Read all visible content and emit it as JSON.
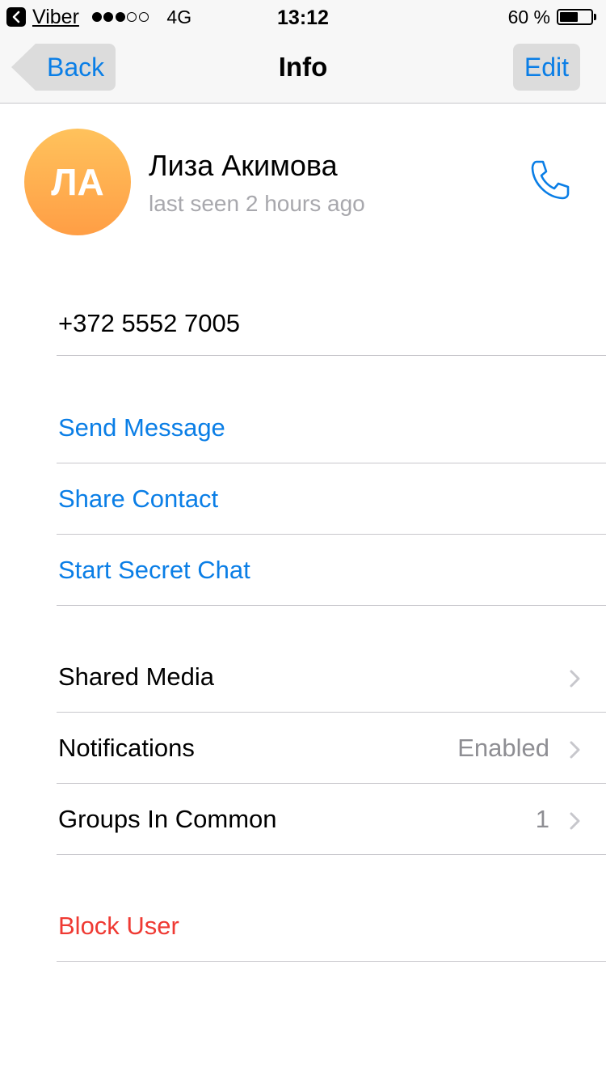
{
  "status_bar": {
    "app_name": "Viber",
    "signal_bars": 3,
    "signal_total": 5,
    "network": "4G",
    "time": "13:12",
    "battery_percent": "60 %",
    "battery_level": 0.6
  },
  "nav": {
    "back_label": "Back",
    "title": "Info",
    "edit_label": "Edit"
  },
  "profile": {
    "avatar_initials": "ЛА",
    "name": "Лиза Акимова",
    "status": "last seen 2 hours ago"
  },
  "phone": "+372 5552 7005",
  "actions": {
    "send_message": "Send Message",
    "share_contact": "Share Contact",
    "start_secret_chat": "Start Secret Chat"
  },
  "settings": {
    "shared_media": "Shared Media",
    "notifications": "Notifications",
    "notifications_value": "Enabled",
    "groups_in_common": "Groups In Common",
    "groups_in_common_value": "1"
  },
  "block_user": "Block User",
  "colors": {
    "accent": "#0a7ee6",
    "danger": "#ef3a33",
    "secondary_text": "#8e8e93",
    "avatar_top": "#ffc25c",
    "avatar_bottom": "#ff9e45"
  }
}
